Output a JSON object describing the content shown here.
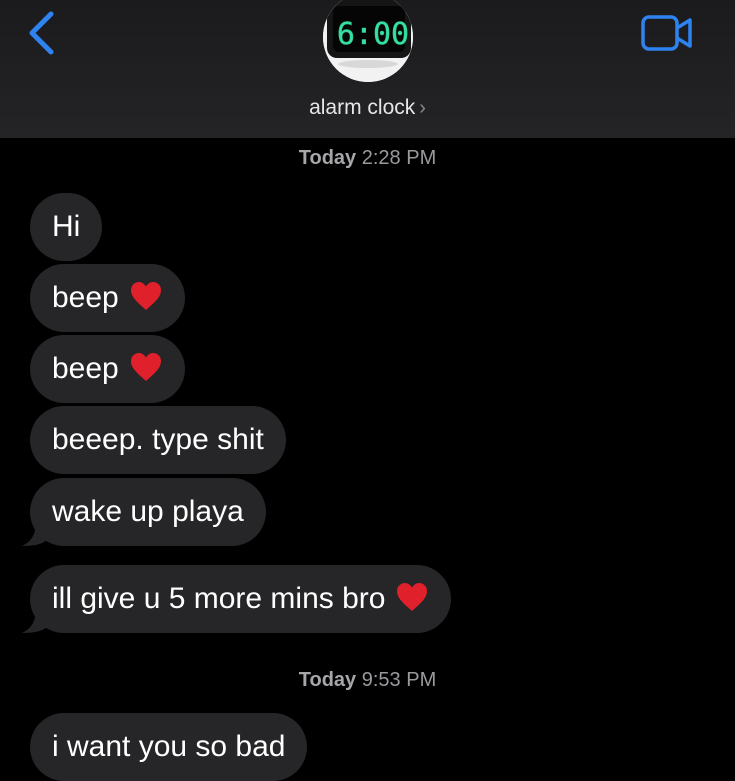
{
  "header": {
    "contact_name": "alarm clock",
    "name_chevron": "›",
    "back_icon": "chevron-left-icon",
    "video_icon": "video-camera-icon",
    "avatar_display": "6:00",
    "accent_color": "#2f83f0"
  },
  "timestamps": [
    {
      "day": "Today",
      "time": "2:28 PM"
    },
    {
      "day": "Today",
      "time": "9:53 PM"
    }
  ],
  "messages": [
    {
      "text": "Hi",
      "emoji": ""
    },
    {
      "text": "beep",
      "emoji": "heart"
    },
    {
      "text": "beep",
      "emoji": "heart"
    },
    {
      "text": "beeep. type shit",
      "emoji": ""
    },
    {
      "text": "wake up playa",
      "emoji": ""
    },
    {
      "text": "ill give u 5 more mins bro",
      "emoji": "heart"
    },
    {
      "text": "i want you so bad",
      "emoji": ""
    }
  ],
  "colors": {
    "background": "#000000",
    "bubble": "#262628",
    "heart": "#e0202a"
  }
}
